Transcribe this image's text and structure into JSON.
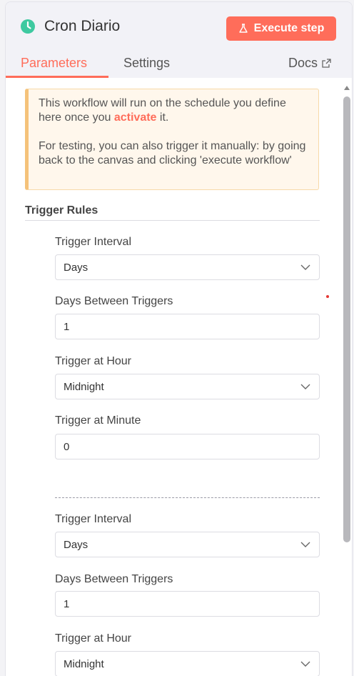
{
  "header": {
    "title": "Cron Diario",
    "execute_label": "Execute step"
  },
  "tabs": {
    "parameters": "Parameters",
    "settings": "Settings",
    "docs": "Docs"
  },
  "notice": {
    "line1_pre": "This workflow will run on the schedule you define here once you ",
    "line1_link": "activate",
    "line1_post": " it.",
    "line2": "For testing, you can also trigger it manually: by going back to the canvas and clicking 'execute workflow'"
  },
  "section": {
    "title": "Trigger Rules"
  },
  "rule1": {
    "interval_label": "Trigger Interval",
    "interval_value": "Days",
    "days_label": "Days Between Triggers",
    "days_value": "1",
    "hour_label": "Trigger at Hour",
    "hour_value": "Midnight",
    "minute_label": "Trigger at Minute",
    "minute_value": "0"
  },
  "rule2": {
    "interval_label": "Trigger Interval",
    "interval_value": "Days",
    "days_label": "Days Between Triggers",
    "days_value": "1",
    "hour_label": "Trigger at Hour",
    "hour_value": "Midnight"
  },
  "colors": {
    "accent": "#ff6d5a",
    "clock": "#3ec9a0",
    "notice_bg": "#fff7ec",
    "notice_border": "#f5c27a"
  },
  "icons": {
    "title": "clock-icon",
    "execute": "flask-icon",
    "docs": "external-link-icon",
    "select": "chevron-down-icon"
  }
}
